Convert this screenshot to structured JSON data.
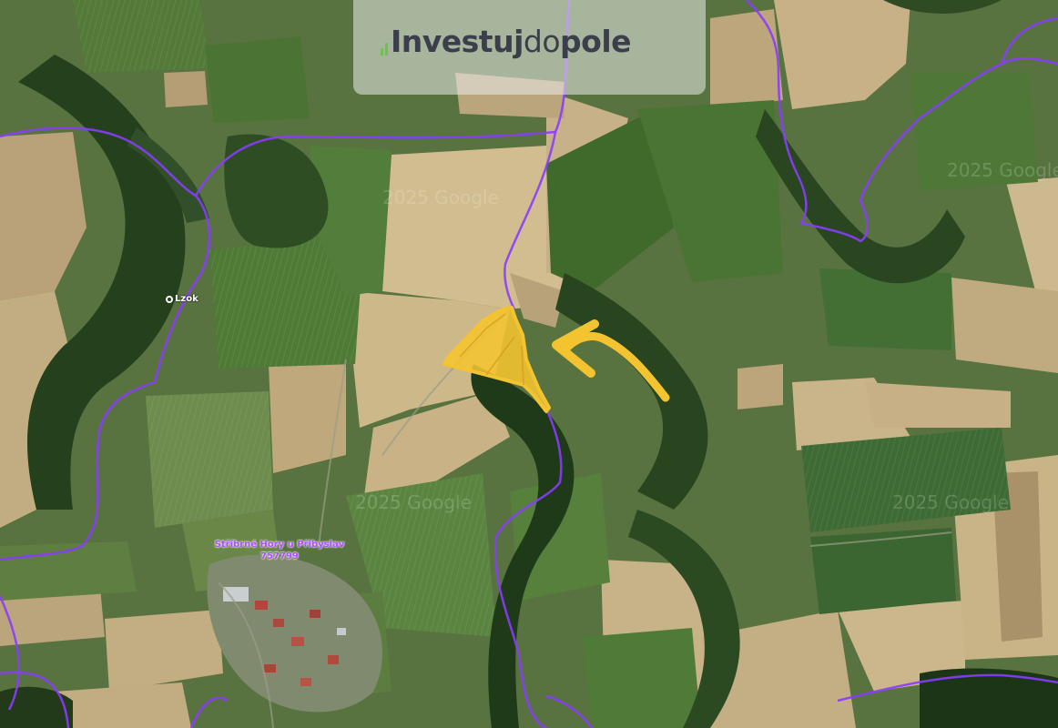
{
  "logo": {
    "part1": "Investuj",
    "part2": "do",
    "part3": "pole"
  },
  "map": {
    "town_label_line1": "Stříbrné Hory u Přibyslav",
    "town_label_line2": "757799",
    "poi_label": "Lzok",
    "watermark": "2025 Google",
    "colors": {
      "boundary": "#8a3cff",
      "parcel_fill": "#f4c430",
      "arrow": "#f4c430"
    }
  }
}
